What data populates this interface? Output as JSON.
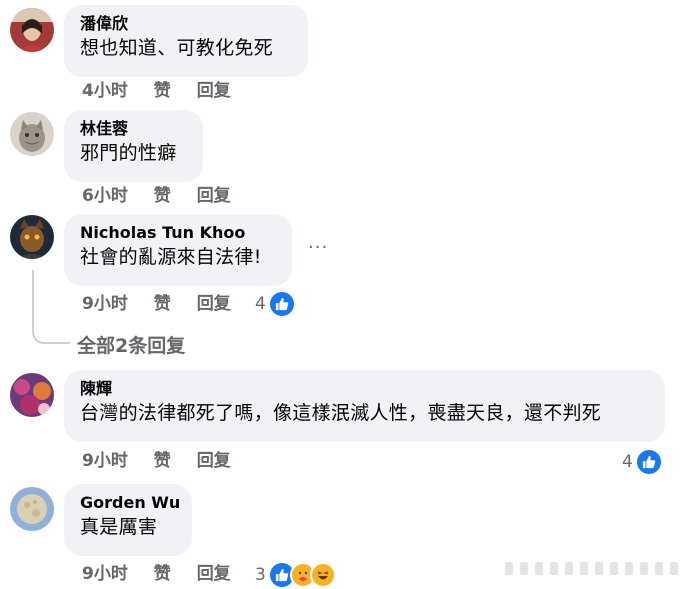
{
  "comments": [
    {
      "name": "潘偉欣",
      "text": "想也知道、可教化免死",
      "time": "4小时",
      "like_label": "赞",
      "reply_label": "回复",
      "reaction_count": ""
    },
    {
      "name": "林佳蓉",
      "text": "邪門的性癖",
      "time": "6小时",
      "like_label": "赞",
      "reply_label": "回复",
      "reaction_count": ""
    },
    {
      "name": "Nicholas Tun Khoo",
      "text": "社會的亂源來自法律!",
      "time": "9小时",
      "like_label": "赞",
      "reply_label": "回复",
      "reaction_count": "4",
      "more_label": "···",
      "replies_link": "全部2条回复"
    },
    {
      "name": "陳輝",
      "text": "台灣的法律都死了嗎，像這樣泯滅人性，喪盡天良，還不判死",
      "time": "9小时",
      "like_label": "赞",
      "reply_label": "回复",
      "reaction_count": "4"
    },
    {
      "name": "Gorden Wu",
      "text": "真是厲害",
      "time": "9小时",
      "like_label": "赞",
      "reply_label": "回复",
      "reaction_count": "3"
    }
  ],
  "colors": {
    "bubble": "#f0f2f5",
    "meta": "#65676b",
    "like_blue": "#1877f2",
    "text": "#050505"
  },
  "icons": [
    "like-icon",
    "care-icon",
    "haha-icon",
    "more-icon"
  ]
}
